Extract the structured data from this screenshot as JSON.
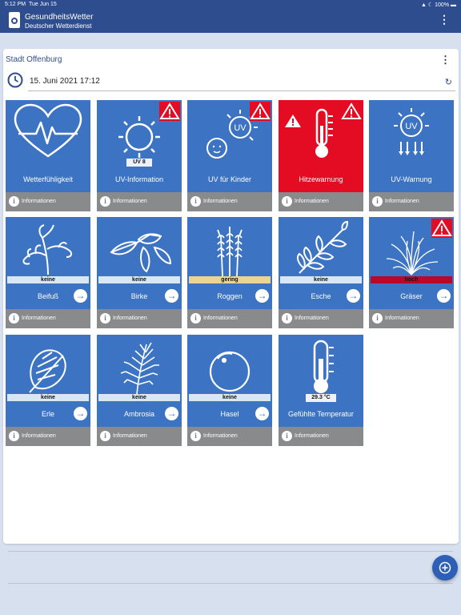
{
  "status_bar": {
    "time": "5:12 PM",
    "date": "Tue Jun 15",
    "battery": "100%"
  },
  "app_bar": {
    "title": "GesundheitsWetter",
    "subtitle": "Deutscher Wetterdienst",
    "menu_icon": "more-vertical-icon"
  },
  "location": {
    "city": "Stadt Offenburg",
    "datetime": "15. Juni 2021 17:12"
  },
  "colors": {
    "tile_blue": "#3c73c2",
    "tile_red": "#e40c23",
    "footer_gray": "#888a8c",
    "header_blue": "#2e4d8f"
  },
  "tiles": [
    {
      "label": "Wetterfühligkeit",
      "info": "Informationen"
    },
    {
      "label": "UV-Information",
      "chip": "UV 8",
      "info": "Informationen"
    },
    {
      "label": "UV für Kinder",
      "info": "Informationen"
    },
    {
      "label": "Hitzewarnung",
      "info": "Informationen"
    },
    {
      "label": "UV-Warnung",
      "info": "Informationen"
    },
    {
      "label": "Beifuß",
      "level": "keine",
      "info": "Informationen"
    },
    {
      "label": "Birke",
      "level": "keine",
      "info": "Informationen"
    },
    {
      "label": "Roggen",
      "level": "gering",
      "info": "Informationen"
    },
    {
      "label": "Esche",
      "level": "keine",
      "info": "Informationen"
    },
    {
      "label": "Gräser",
      "level": "hoch",
      "info": "Informationen"
    },
    {
      "label": "Erle",
      "level": "keine",
      "info": "Informationen"
    },
    {
      "label": "Ambrosia",
      "level": "keine",
      "info": "Informationen"
    },
    {
      "label": "Hasel",
      "level": "keine",
      "info": "Informationen"
    },
    {
      "label": "Gefühlte Temperatur",
      "level": "29.3 °C",
      "info": "Informationen"
    }
  ],
  "uv_symbol": "UV"
}
